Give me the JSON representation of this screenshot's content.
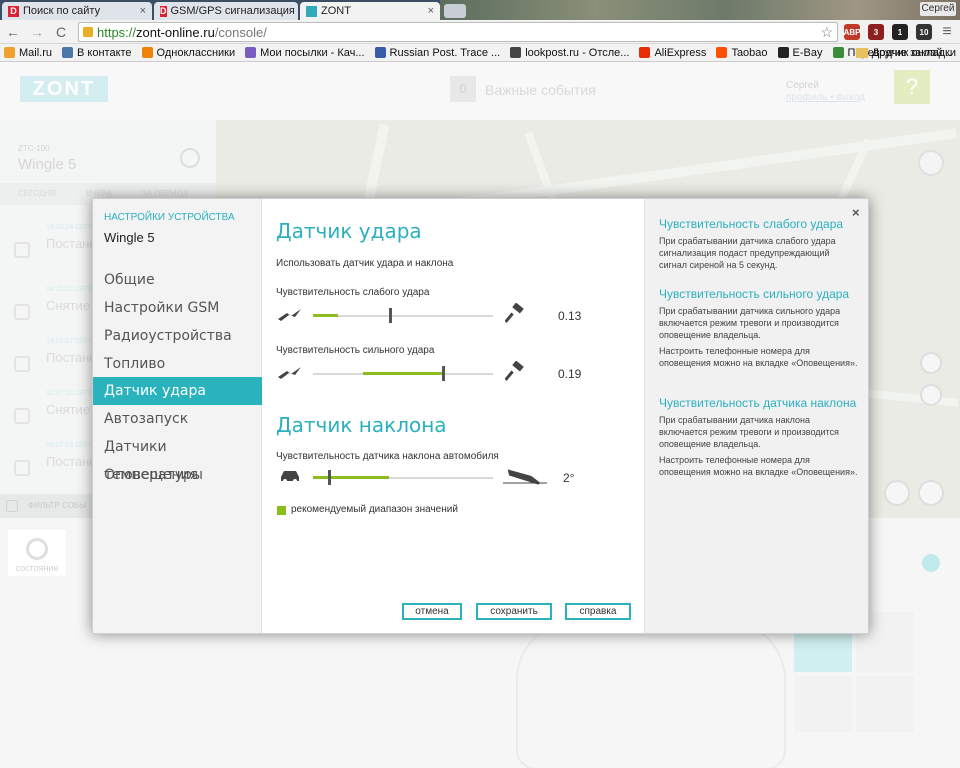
{
  "browser": {
    "tabs": [
      {
        "favicon": "D",
        "title": "Поиск по сайту"
      },
      {
        "favicon": "D",
        "title": "GSM/GPS сигнализация"
      },
      {
        "favicon": "Z",
        "title": "ZONT"
      }
    ],
    "close_glyph": "×",
    "user_chip": "Сергей",
    "back_glyph": "←",
    "forward_glyph": "→",
    "reload_glyph": "C",
    "menu_glyph": "≡",
    "url": {
      "scheme": "https://",
      "host": "zont-online.ru",
      "path": "/console/"
    },
    "star_glyph": "☆",
    "extensions": [
      {
        "name": "adblock-icon",
        "label": "ABP",
        "color": "#c0392b"
      },
      {
        "name": "ublock-icon",
        "label": "3",
        "color": "#8e1f1f"
      },
      {
        "name": "mail-ext-icon",
        "label": "1",
        "color": "#222222"
      },
      {
        "name": "linkedin-ext-icon",
        "label": "10",
        "color": "#333333"
      }
    ],
    "bookmarks": [
      {
        "label": "Mail.ru",
        "color": "#f0a030"
      },
      {
        "label": "В контакте",
        "color": "#4a76a8"
      },
      {
        "label": "Одноклассники",
        "color": "#ee8208"
      },
      {
        "label": "Мои посылки - Кач...",
        "color": "#7a5cc0"
      },
      {
        "label": "Russian Post. Trace ...",
        "color": "#3a5ca8"
      },
      {
        "label": "lookpost.ru - Отсле...",
        "color": "#444444"
      },
      {
        "label": "AliExpress",
        "color": "#e62e04"
      },
      {
        "label": "Taobao",
        "color": "#ff5000"
      },
      {
        "label": "E-Bay",
        "color": "#222222"
      },
      {
        "label": "Переводчик онлай...",
        "color": "#3c8c3c"
      }
    ],
    "bookmarks_other": "Другие закладки"
  },
  "app": {
    "logo": "ZONT",
    "events_count": "0",
    "events_label": "Важные события",
    "user_name": "Сергей",
    "user_links": "профиль • выход",
    "help_glyph": "?",
    "device_type": "ZTC-100",
    "device_name": "Wingle 5",
    "device_tabs": [
      "СЕГОДНЯ",
      "ВЧЕРА",
      "ЗА ПЕРИОД"
    ],
    "events": [
      {
        "time": "14:10:24 СЕГОДНЯ",
        "title": "Постано"
      },
      {
        "time": "14:25:02 СЕГОДНЯ",
        "title": "Снятие"
      },
      {
        "time": "14:22:17 СЕГОДНЯ",
        "title": "Постано"
      },
      {
        "time": "12:57:33 СЕГОДНЯ",
        "title": "Снятие"
      },
      {
        "time": "09:07:12 СЕГОДНЯ",
        "title": "Постано"
      }
    ],
    "filter_label": "ФИЛЬТР СОБЫ",
    "state_label": "состояние"
  },
  "dialog": {
    "section_title": "НАСТРОЙКИ УСТРОЙСТВА",
    "device_name": "Wingle 5",
    "menu": [
      "Общие",
      "Настройки GSM",
      "Радиоустройства",
      "Топливо",
      "Датчик удара",
      "Автозапуск",
      "Датчики температуры",
      "Оповещения"
    ],
    "selected_index": 4,
    "shock": {
      "heading": "Датчик удара",
      "use_label": "Использовать датчик удара и наклона",
      "weak": {
        "label": "Чувствительность слабого удара",
        "value_text": "0.13",
        "range": [
          0.0,
          0.14
        ],
        "level": 0.43
      },
      "strong": {
        "label": "Чувствительность сильного удара",
        "value_text": "0.19",
        "range": [
          0.28,
          0.72
        ],
        "level": 0.72
      }
    },
    "tilt": {
      "heading": "Датчик наклона",
      "label": "Чувствительность датчика наклона автомобиля",
      "value_text": "2°",
      "range": [
        0.0,
        0.42
      ],
      "level": 0.09
    },
    "legend": "рекомендуемый диапазон значений",
    "buttons": {
      "cancel": "отмена",
      "save": "сохранить",
      "help": "справка"
    },
    "help": {
      "close_glyph": "×",
      "sections": [
        {
          "title": "Чувствительность слабого удара",
          "paras": [
            "При срабатывании датчика слабого удара сигнализация подаст предупреждающий сигнал сиреной на 5 секунд."
          ]
        },
        {
          "title": "Чувствительность сильного удара",
          "paras": [
            "При срабатывании датчика сильного удара включается режим тревоги и производится оповещение владельца.",
            "Настроить телефонные номера для оповещения можно на вкладке «Оповещения»."
          ]
        },
        {
          "title": "Чувствительность датчика наклона",
          "paras": [
            "При срабатывании датчика наклона включается режим тревоги и производится оповещение владельца.",
            "Настроить телефонные номера для оповещения можно на вкладке «Оповещения»."
          ]
        }
      ]
    }
  },
  "colors": {
    "accent": "#2bb3bd",
    "range": "#8cbc1e"
  }
}
